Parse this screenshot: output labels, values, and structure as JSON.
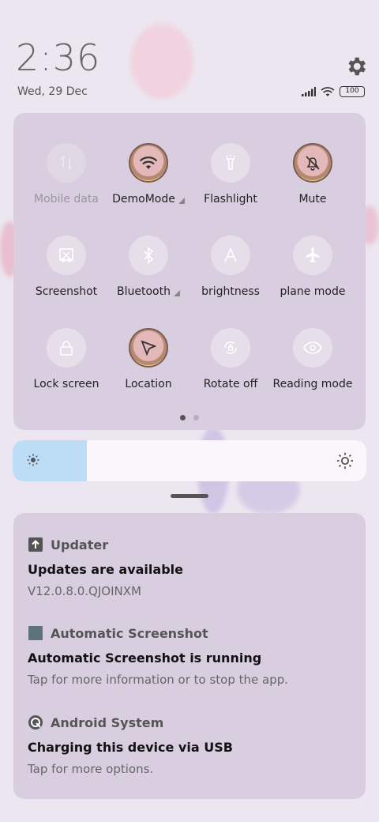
{
  "status_bar": {
    "time": "2:36",
    "date": "Wed, 29 Dec",
    "battery": "100",
    "icons": [
      "signal-icon",
      "wifi-icon",
      "battery-icon",
      "settings-gear-icon"
    ]
  },
  "quick_settings": {
    "tiles": [
      {
        "label": "Mobile data",
        "icon": "mobile-data-icon",
        "state": "disabled"
      },
      {
        "label": "DemoMode",
        "icon": "wifi-icon",
        "state": "active",
        "has_more": true
      },
      {
        "label": "Flashlight",
        "icon": "flashlight-icon",
        "state": "off"
      },
      {
        "label": "Mute",
        "icon": "bell-off-icon",
        "state": "active"
      },
      {
        "label": "Screenshot",
        "icon": "screenshot-icon",
        "state": "off"
      },
      {
        "label": "Bluetooth",
        "icon": "bluetooth-icon",
        "state": "off",
        "has_more": true
      },
      {
        "label": "brightness",
        "icon": "auto-brightness-icon",
        "state": "off"
      },
      {
        "label": "plane mode",
        "icon": "airplane-icon",
        "state": "off"
      },
      {
        "label": "Lock screen",
        "icon": "lock-icon",
        "state": "off"
      },
      {
        "label": "Location",
        "icon": "location-arrow-icon",
        "state": "active"
      },
      {
        "label": "Rotate off",
        "icon": "rotate-lock-icon",
        "state": "off"
      },
      {
        "label": "Reading mode",
        "icon": "eye-icon",
        "state": "off"
      }
    ],
    "page_count": 2,
    "current_page": 1
  },
  "brightness": {
    "level_fraction": 0.21
  },
  "notifications": [
    {
      "app": "Updater",
      "icon": "updater-arrow-icon",
      "title": "Updates are available",
      "text": "V12.0.8.0.QJOINXM"
    },
    {
      "app": "Automatic Screenshot",
      "icon": "automatic-screenshot-app-icon",
      "title": "Automatic Screenshot is running",
      "text": "Tap for more information or to stop the app."
    },
    {
      "app": "Android System",
      "icon": "android-system-icon",
      "title": "Charging this device via USB",
      "text": "Tap for more options."
    }
  ],
  "colors": {
    "panel": "#d8cee0",
    "active_tile_border": "#7b5b55",
    "brightness_fill": "#bddcf6"
  }
}
